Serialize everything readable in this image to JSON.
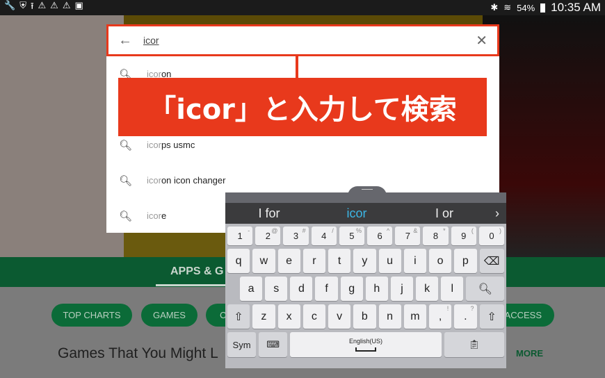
{
  "status_bar": {
    "left_icons": [
      "wrench-icon",
      "shield-icon",
      "upload-icon",
      "warning-icon",
      "warning-icon",
      "warning-icon",
      "image-icon"
    ],
    "battery": "54%",
    "time": "10:35 AM"
  },
  "search": {
    "query": "icor",
    "typed_prefix": "icor"
  },
  "suggestions": [
    {
      "prefix": "icor",
      "rest": "on"
    },
    {
      "prefix": "icor",
      "rest": "ps usmc"
    },
    {
      "prefix": "icor",
      "rest": "on icon changer"
    },
    {
      "prefix": "icor",
      "rest": "e"
    }
  ],
  "annotation": "「icor」と入力して検索",
  "background": {
    "tab": "APPS & G",
    "chips": [
      "TOP CHARTS",
      "GAMES",
      "C",
      "ACCESS"
    ],
    "section_title": "Games That You Might L",
    "more": "MORE"
  },
  "keyboard": {
    "predictions": [
      "I for",
      "icor",
      "I or"
    ],
    "selected_prediction": "icor",
    "number_row": [
      [
        "1",
        "-"
      ],
      [
        "2",
        "@"
      ],
      [
        "3",
        "#"
      ],
      [
        "4",
        "/"
      ],
      [
        "5",
        "%"
      ],
      [
        "6",
        "^"
      ],
      [
        "7",
        "&"
      ],
      [
        "8",
        "*"
      ],
      [
        "9",
        "("
      ],
      [
        "0",
        ")"
      ]
    ],
    "row1": [
      "q",
      "w",
      "e",
      "r",
      "t",
      "y",
      "u",
      "i",
      "o",
      "p"
    ],
    "row2": [
      "a",
      "s",
      "d",
      "f",
      "g",
      "h",
      "j",
      "k",
      "l"
    ],
    "row3": [
      "z",
      "x",
      "c",
      "v",
      "b",
      "n",
      "m",
      ",!",
      ".?"
    ],
    "sym": "Sym",
    "space_label": "English(US)"
  },
  "colors": {
    "accent_red": "#e8391c",
    "play_green": "#0b5a31",
    "prediction_blue": "#3cb6e6"
  }
}
